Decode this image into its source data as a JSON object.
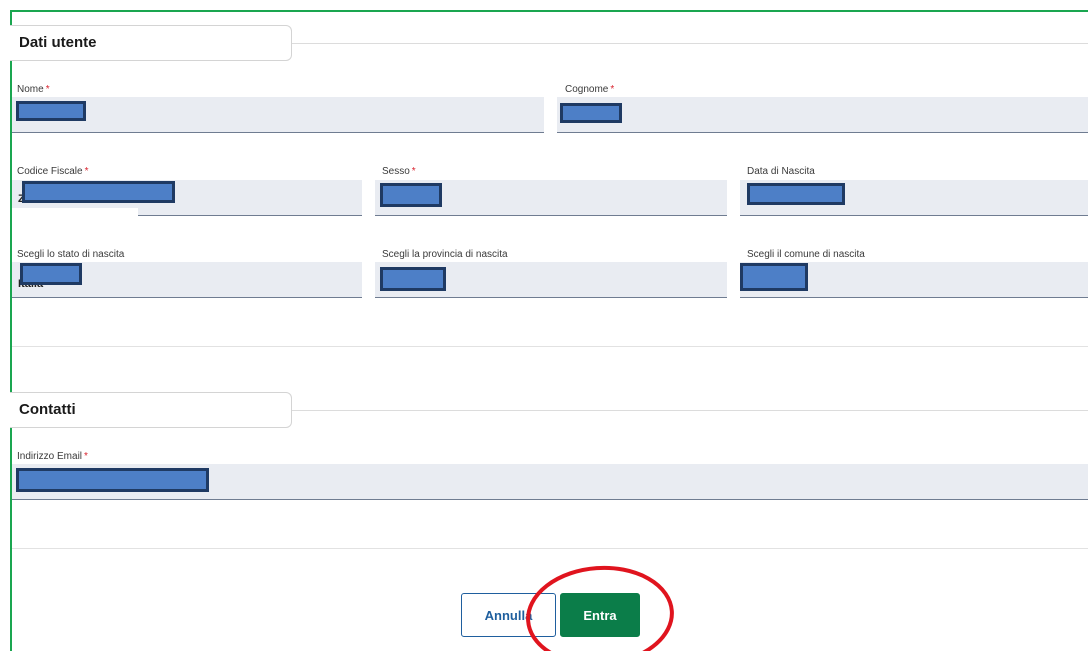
{
  "sections": {
    "user_data_title": "Dati utente",
    "contacts_title": "Contatti"
  },
  "fields": {
    "nome": {
      "label": "Nome",
      "required_mark": "*",
      "value": ""
    },
    "cognome": {
      "label": "Cognome",
      "required_mark": "*",
      "value": ""
    },
    "codice_fiscale": {
      "label": "Codice Fiscale",
      "required_mark": "*",
      "value": "ZZZZZZZZZZZZZZZZ"
    },
    "sesso": {
      "label": "Sesso",
      "required_mark": "*",
      "value": ""
    },
    "data_nascita": {
      "label": "Data di Nascita",
      "value": ""
    },
    "stato_nascita": {
      "label": "Scegli lo stato di nascita",
      "value": "Italia"
    },
    "provincia_nascita": {
      "label": "Scegli la provincia di nascita",
      "value": ""
    },
    "comune_nascita": {
      "label": "Scegli il comune di nascita",
      "value": ""
    },
    "email": {
      "label": "Indirizzo Email",
      "required_mark": "*",
      "value": ""
    }
  },
  "buttons": {
    "cancel_label": "Annulla",
    "enter_label": "Entra"
  },
  "colors": {
    "frame": "#1aa650",
    "field_bg": "#e9ecf2",
    "redaction": "#4d7fc7",
    "primary": "#0b7d49",
    "cancel": "#1f5f9e",
    "highlight": "#e0141e"
  }
}
